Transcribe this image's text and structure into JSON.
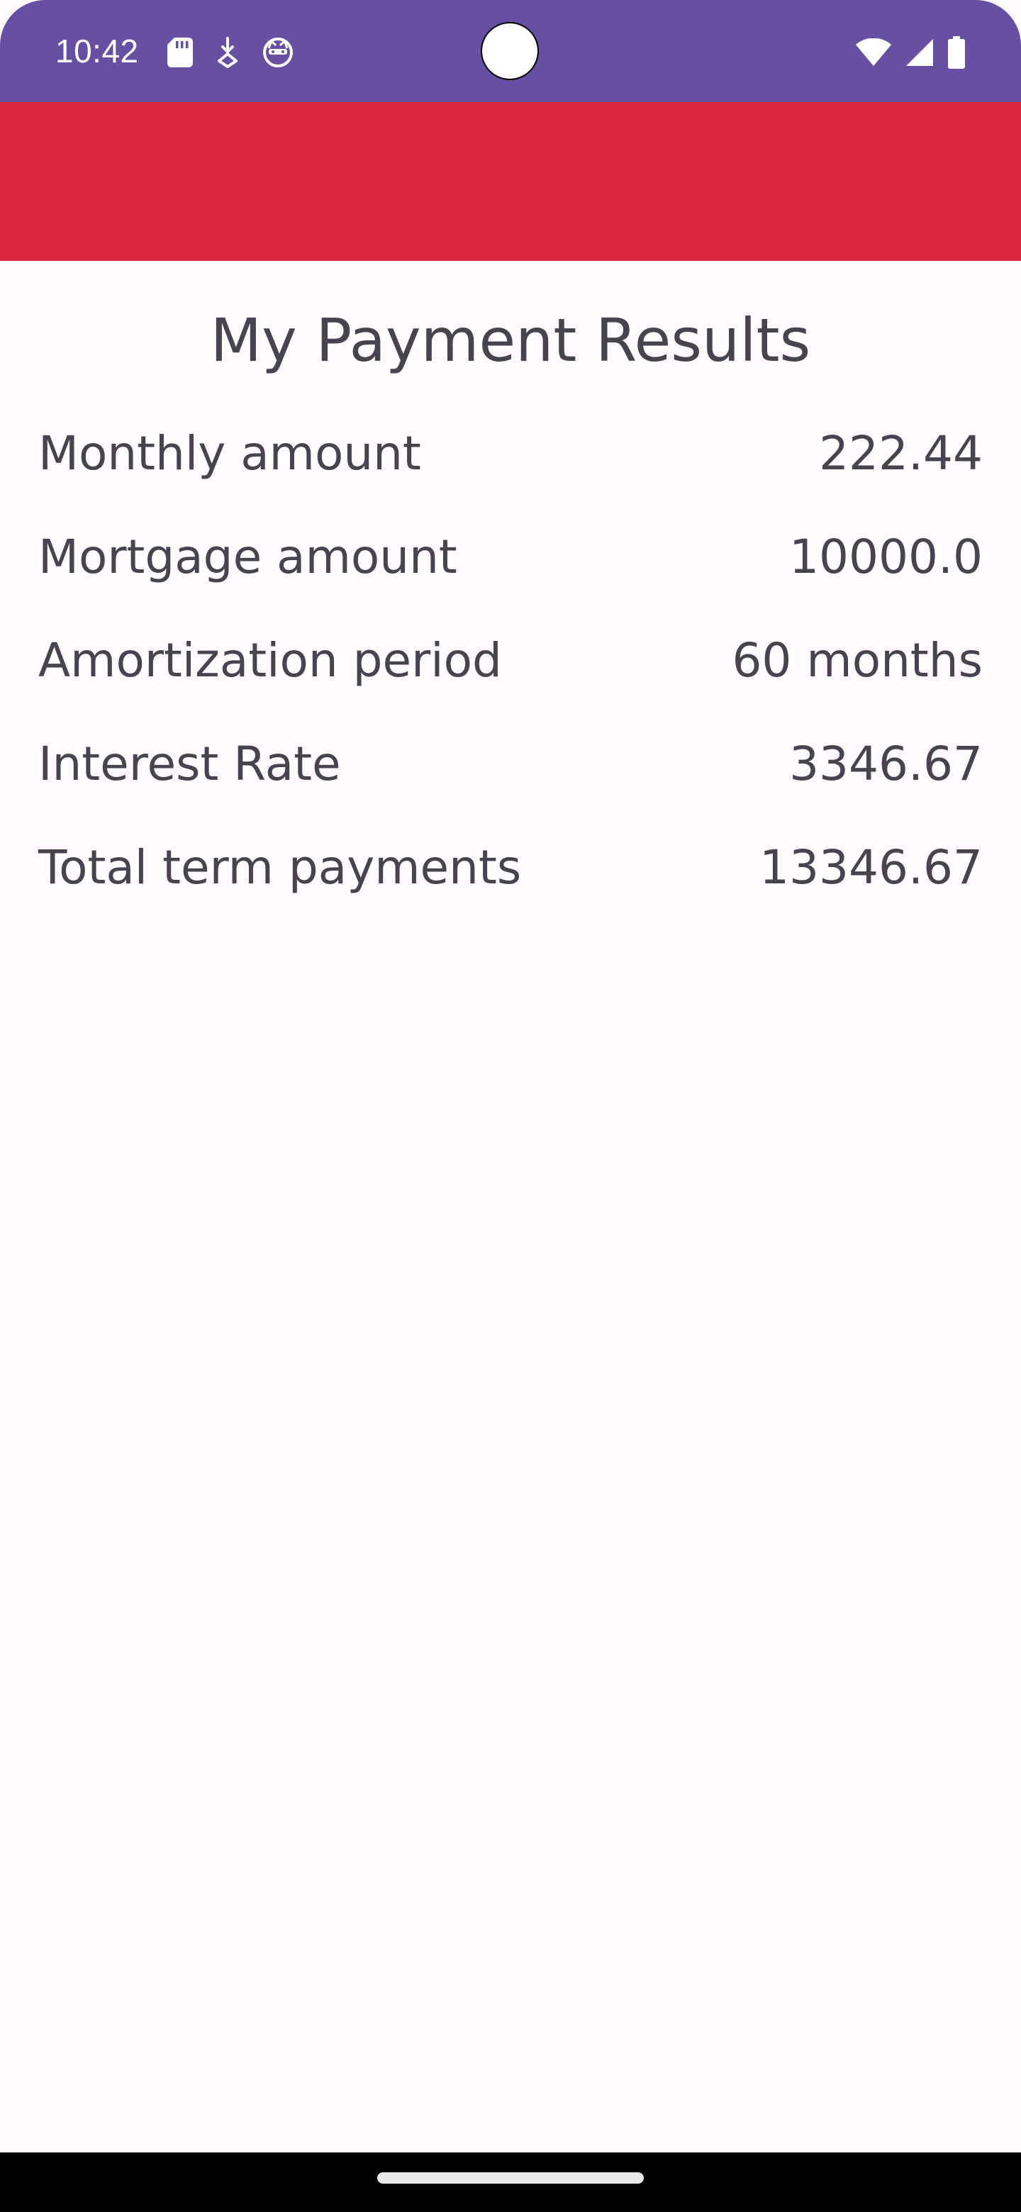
{
  "status_bar": {
    "time": "10:42",
    "left_icons": [
      "sd-card-icon",
      "download-icon",
      "cat-face-icon"
    ],
    "right_icons": [
      "wifi-icon",
      "cell-signal-icon",
      "battery-icon"
    ],
    "background_color": "#6750a4"
  },
  "app_bar": {
    "background_color": "#d9263e"
  },
  "page": {
    "title": "My Payment Results"
  },
  "results": [
    {
      "label": "Monthly amount",
      "value": "222.44"
    },
    {
      "label": "Mortgage amount",
      "value": "10000.0"
    },
    {
      "label": "Amortization period",
      "value": "60 months"
    },
    {
      "label": "Interest Rate",
      "value": "3346.67"
    },
    {
      "label": "Total term payments",
      "value": "13346.67"
    }
  ],
  "colors": {
    "text": "#46454f",
    "background": "#fffbff",
    "nav_bar": "#000000"
  }
}
